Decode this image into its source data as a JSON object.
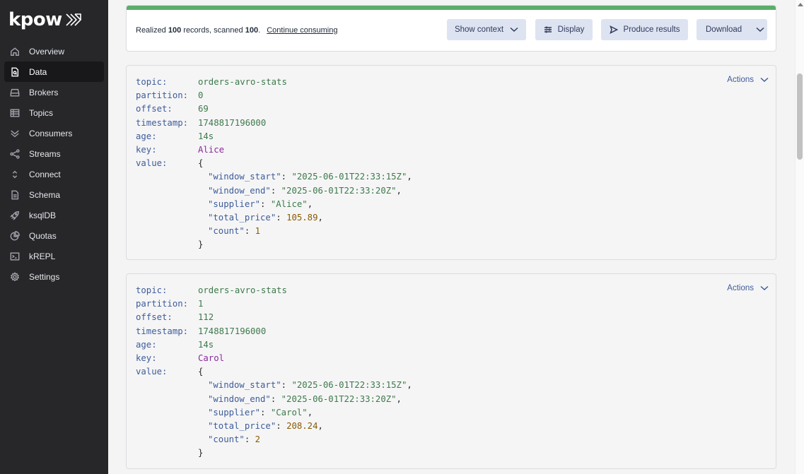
{
  "brand": {
    "name": "kpow"
  },
  "sidebar": {
    "items": [
      {
        "label": "Overview",
        "icon": "home-icon"
      },
      {
        "label": "Data",
        "icon": "document-icon",
        "active": true
      },
      {
        "label": "Brokers",
        "icon": "server-icon"
      },
      {
        "label": "Topics",
        "icon": "table-icon"
      },
      {
        "label": "Consumers",
        "icon": "double-chevron-icon"
      },
      {
        "label": "Streams",
        "icon": "share-icon"
      },
      {
        "label": "Connect",
        "icon": "chevron-updown-icon"
      },
      {
        "label": "Schema",
        "icon": "file-text-icon"
      },
      {
        "label": "ksqlDB",
        "icon": "rocket-icon"
      },
      {
        "label": "Quotas",
        "icon": "pie-chart-icon"
      },
      {
        "label": "kREPL",
        "icon": "terminal-icon"
      },
      {
        "label": "Settings",
        "icon": "gear-icon"
      }
    ]
  },
  "toolbar": {
    "progress_fraction": 1.0,
    "status_prefix": "Realized ",
    "realized_count": "100",
    "status_middle": " records, scanned ",
    "scanned_count": "100",
    "status_suffix": ".",
    "continue_label": "Continue consuming",
    "show_context_label": "Show context",
    "display_label": "Display",
    "produce_results_label": "Produce results",
    "download_label": "Download"
  },
  "records": [
    {
      "actions_label": "Actions",
      "fields": {
        "topic": {
          "label": "topic:",
          "value": "orders-avro-stats"
        },
        "partition": {
          "label": "partition:",
          "value": "0"
        },
        "offset": {
          "label": "offset:",
          "value": "69"
        },
        "timestamp": {
          "label": "timestamp:",
          "value": "1748817196000"
        },
        "age": {
          "label": "age:",
          "value": "14s"
        },
        "key": {
          "label": "key:",
          "value": "Alice"
        },
        "value": {
          "label": "value:"
        }
      },
      "value_json": {
        "open": "{",
        "close": "}",
        "window_start": {
          "key": "\"window_start\"",
          "val": "\"2025-06-01T22:33:15Z\""
        },
        "window_end": {
          "key": "\"window_end\"",
          "val": "\"2025-06-01T22:33:20Z\""
        },
        "supplier": {
          "key": "\"supplier\"",
          "val": "\"Alice\""
        },
        "total_price": {
          "key": "\"total_price\"",
          "val": "105.89"
        },
        "count": {
          "key": "\"count\"",
          "val": "1"
        }
      }
    },
    {
      "actions_label": "Actions",
      "fields": {
        "topic": {
          "label": "topic:",
          "value": "orders-avro-stats"
        },
        "partition": {
          "label": "partition:",
          "value": "1"
        },
        "offset": {
          "label": "offset:",
          "value": "112"
        },
        "timestamp": {
          "label": "timestamp:",
          "value": "1748817196000"
        },
        "age": {
          "label": "age:",
          "value": "14s"
        },
        "key": {
          "label": "key:",
          "value": "Carol"
        },
        "value": {
          "label": "value:"
        }
      },
      "value_json": {
        "open": "{",
        "close": "}",
        "window_start": {
          "key": "\"window_start\"",
          "val": "\"2025-06-01T22:33:15Z\""
        },
        "window_end": {
          "key": "\"window_end\"",
          "val": "\"2025-06-01T22:33:20Z\""
        },
        "supplier": {
          "key": "\"supplier\"",
          "val": "\"Carol\""
        },
        "total_price": {
          "key": "\"total_price\"",
          "val": "208.24"
        },
        "count": {
          "key": "\"count\"",
          "val": "2"
        }
      }
    }
  ],
  "colors": {
    "sidebar_bg": "#27272a",
    "active_nav_bg": "#18181b",
    "progress_green": "#5bae6a",
    "button_bg": "#dde3f1",
    "json_key": "#3d5c99",
    "json_string": "#3d7a4a",
    "json_number": "#8a5a00",
    "record_key": "#8b2a9b"
  }
}
